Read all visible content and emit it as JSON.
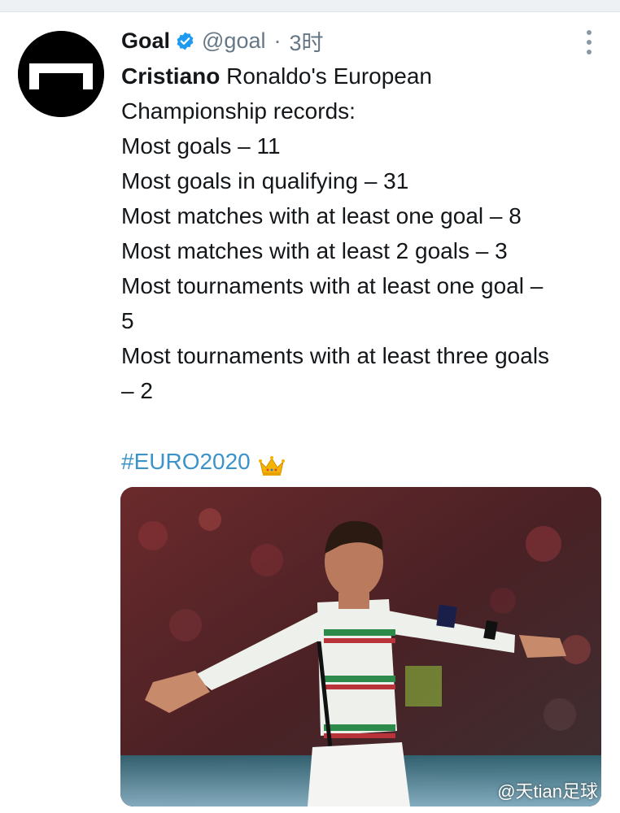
{
  "tweet": {
    "author": {
      "display_name": "Goal",
      "handle": "@goal",
      "separator": "·",
      "time": "3时",
      "verified_icon": "verified-badge-icon",
      "avatar_icon": "goal-logo-icon"
    },
    "body": {
      "line1_bold": "Cristiano",
      "line1_rest": " Ronaldo's European",
      "lines": [
        "Championship records:",
        "Most goals – 11",
        "Most goals in qualifying – 31",
        "Most matches with at least one goal – 8",
        "Most matches with at least 2 goals – 3",
        "Most tournaments with at least one goal –",
        "5",
        "Most tournaments with at least three goals",
        "– 2"
      ]
    },
    "hashtag": "#EURO2020",
    "hashtag_emoji": "crown-icon",
    "media": {
      "watermark": "@天tian足球"
    },
    "more_icon": "more-vertical-icon"
  },
  "colors": {
    "text": "#14171a",
    "muted": "#657786",
    "link": "#3b93c9",
    "verified": "#1d9bf0"
  }
}
